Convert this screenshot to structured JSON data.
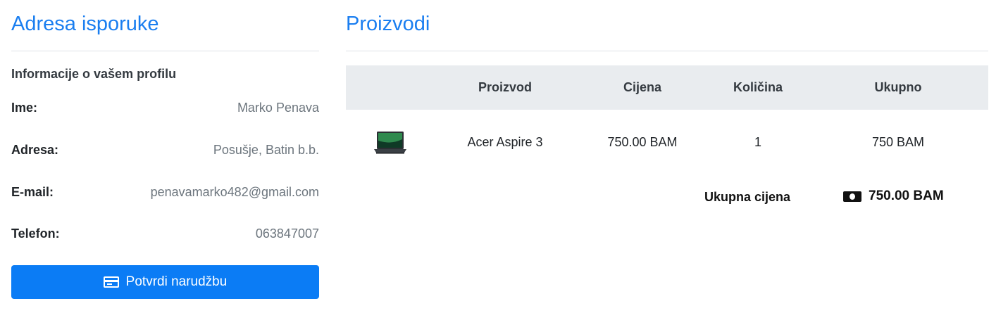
{
  "shipping": {
    "title": "Adresa isporuke",
    "profile_heading": "Informacije o vašem profilu",
    "fields": [
      {
        "label": "Ime:",
        "value": "Marko Penava"
      },
      {
        "label": "Adresa:",
        "value": "Posušje, Batin b.b."
      },
      {
        "label": "E-mail:",
        "value": "penavamarko482@gmail.com"
      },
      {
        "label": "Telefon:",
        "value": "063847007"
      }
    ],
    "confirm_button": {
      "label": "Potvrdi narudžbu",
      "icon": "credit-card-icon",
      "color": "#0b7cf5"
    }
  },
  "products": {
    "title": "Proizvodi",
    "columns": [
      "",
      "Proizvod",
      "Cijena",
      "Količina",
      "Ukupno"
    ],
    "rows": [
      {
        "image": "laptop-image",
        "name": "Acer Aspire 3",
        "price": "750.00 BAM",
        "quantity": "1",
        "total": "750 BAM"
      }
    ],
    "total_label": "Ukupna cijena",
    "total_value": "750.00 BAM",
    "total_icon": "money-bill-icon"
  },
  "colors": {
    "accent": "#1a7ef0",
    "table_header_bg": "#e9ecef",
    "muted_text": "#6c757d"
  }
}
